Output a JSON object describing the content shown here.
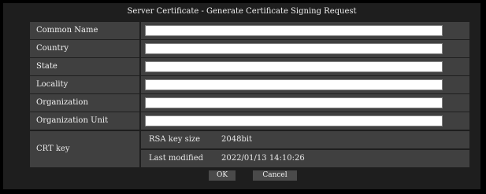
{
  "window": {
    "title": "Server Certificate - Generate Certificate Signing Request"
  },
  "fields": [
    {
      "label": "Common Name",
      "value": ""
    },
    {
      "label": "Country",
      "value": ""
    },
    {
      "label": "State",
      "value": ""
    },
    {
      "label": "Locality",
      "value": ""
    },
    {
      "label": "Organization",
      "value": ""
    },
    {
      "label": "Organization Unit",
      "value": ""
    }
  ],
  "crt": {
    "label": "CRT key",
    "key_size_label": "RSA key size",
    "key_size_value": "2048bit",
    "modified_label": "Last modified",
    "modified_value": "2022/01/13 14:10:26"
  },
  "buttons": {
    "ok": "OK",
    "cancel": "Cancel"
  }
}
